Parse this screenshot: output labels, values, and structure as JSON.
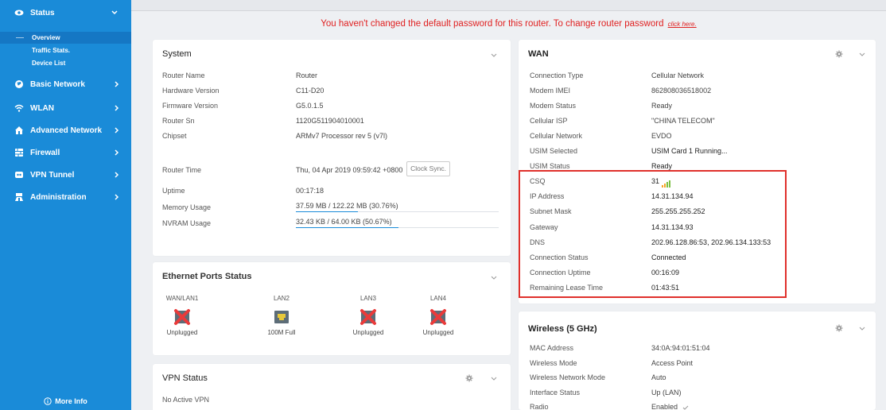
{
  "sidebar": {
    "status": {
      "label": "Status",
      "icon": "eye-icon"
    },
    "sub_items": [
      {
        "label": "Overview",
        "active": true
      },
      {
        "label": "Traffic Stats.",
        "active": false
      },
      {
        "label": "Device List",
        "active": false
      }
    ],
    "items": [
      {
        "label": "Basic Network",
        "icon": "globe-icon"
      },
      {
        "label": "WLAN",
        "icon": "wifi-icon"
      },
      {
        "label": "Advanced Network",
        "icon": "house-icon"
      },
      {
        "label": "Firewall",
        "icon": "firewall-icon"
      },
      {
        "label": "VPN Tunnel",
        "icon": "vpn-icon"
      },
      {
        "label": "Administration",
        "icon": "admin-icon"
      }
    ],
    "more_info": "More Info"
  },
  "warning": {
    "text": "You haven't changed the default password for this router. To change router password",
    "link": "click here."
  },
  "system": {
    "title": "System",
    "rows": [
      {
        "label": "Router Name",
        "value": "Router"
      },
      {
        "label": "Hardware Version",
        "value": "C11-D20"
      },
      {
        "label": "Firmware Version",
        "value": "G5.0.1.5"
      },
      {
        "label": "Router Sn",
        "value": "1120G511904010001"
      },
      {
        "label": "Chipset",
        "value": "ARMv7 Processor rev 5 (v7l)"
      }
    ],
    "time_label": "Router Time",
    "time_value": "Thu, 04 Apr 2019 09:59:42 +0800",
    "sync_button": "Clock Sync.",
    "uptime_label": "Uptime",
    "uptime_value": "00:17:18",
    "memory_label": "Memory Usage",
    "memory_value": "37.59 MB / 122.22 MB (30.76%)",
    "memory_percent": 30.76,
    "nvram_label": "NVRAM Usage",
    "nvram_value": "32.43 KB / 64.00 KB (50.67%)",
    "nvram_percent": 50.67
  },
  "ethernet": {
    "title": "Ethernet Ports Status",
    "ports": [
      {
        "name": "WAN/LAN1",
        "state": "Unplugged",
        "icon": "unplugged-port-icon"
      },
      {
        "name": "LAN2",
        "state": "100M Full",
        "icon": "connected-port-icon"
      },
      {
        "name": "LAN3",
        "state": "Unplugged",
        "icon": "unplugged-port-icon"
      },
      {
        "name": "LAN4",
        "state": "Unplugged",
        "icon": "unplugged-port-icon"
      }
    ]
  },
  "vpn": {
    "title": "VPN Status",
    "text": "No Active VPN"
  },
  "wan": {
    "title": "WAN",
    "rows": [
      {
        "label": "Connection Type",
        "value": "Cellular Network"
      },
      {
        "label": "Modem IMEI",
        "value": "862808036518002"
      },
      {
        "label": "Modem Status",
        "value": "Ready"
      },
      {
        "label": "Cellular ISP",
        "value": "\"CHINA TELECOM\""
      },
      {
        "label": "Cellular Network",
        "value": "EVDO"
      },
      {
        "label": "USIM Selected",
        "value": "USIM Card 1 Running..."
      },
      {
        "label": "USIM Status",
        "value": "Ready"
      },
      {
        "label": "CSQ",
        "value": "31"
      },
      {
        "label": "IP Address",
        "value": "14.31.134.94"
      },
      {
        "label": "Subnet Mask",
        "value": "255.255.255.252"
      },
      {
        "label": "Gateway",
        "value": "14.31.134.93"
      },
      {
        "label": "DNS",
        "value": "202.96.128.86:53, 202.96.134.133:53"
      },
      {
        "label": "Connection Status",
        "value": "Connected"
      },
      {
        "label": "Connection Uptime",
        "value": "00:16:09"
      },
      {
        "label": "Remaining Lease Time",
        "value": "01:43:51"
      }
    ]
  },
  "wireless": {
    "title": "Wireless (5 GHz)",
    "rows": [
      {
        "label": "MAC Address",
        "value": "34:0A:94:01:51:04"
      },
      {
        "label": "Wireless Mode",
        "value": "Access Point"
      },
      {
        "label": "Wireless Network Mode",
        "value": "Auto"
      },
      {
        "label": "Interface Status",
        "value": "Up (LAN)"
      },
      {
        "label": "Radio",
        "value": "Enabled"
      }
    ]
  },
  "colors": {
    "sidebar": "#1a8bd8",
    "warning": "#e02020",
    "highlight": "#e0302b"
  }
}
